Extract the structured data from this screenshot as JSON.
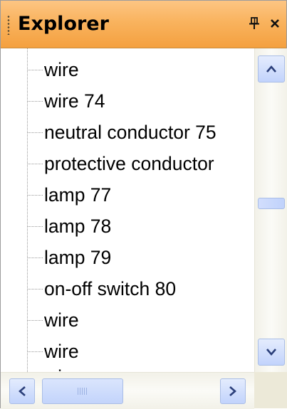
{
  "panel": {
    "title": "Explorer",
    "pin_icon": "pin-icon",
    "close_icon": "close-icon",
    "accent_color": "#f9b35e"
  },
  "tree": {
    "items": [
      {
        "label": "wire"
      },
      {
        "label": "wire 74"
      },
      {
        "label": "neutral conductor 75"
      },
      {
        "label": "protective conductor"
      },
      {
        "label": "lamp 77"
      },
      {
        "label": "lamp 78"
      },
      {
        "label": "lamp 79"
      },
      {
        "label": "on-off switch 80"
      },
      {
        "label": "wire"
      },
      {
        "label": "wire"
      },
      {
        "label": "wire"
      }
    ]
  },
  "scrollbars": {
    "vertical": {
      "up_icon": "chevron-up-icon",
      "down_icon": "chevron-down-icon"
    },
    "horizontal": {
      "left_icon": "chevron-left-icon",
      "right_icon": "chevron-right-icon"
    }
  }
}
